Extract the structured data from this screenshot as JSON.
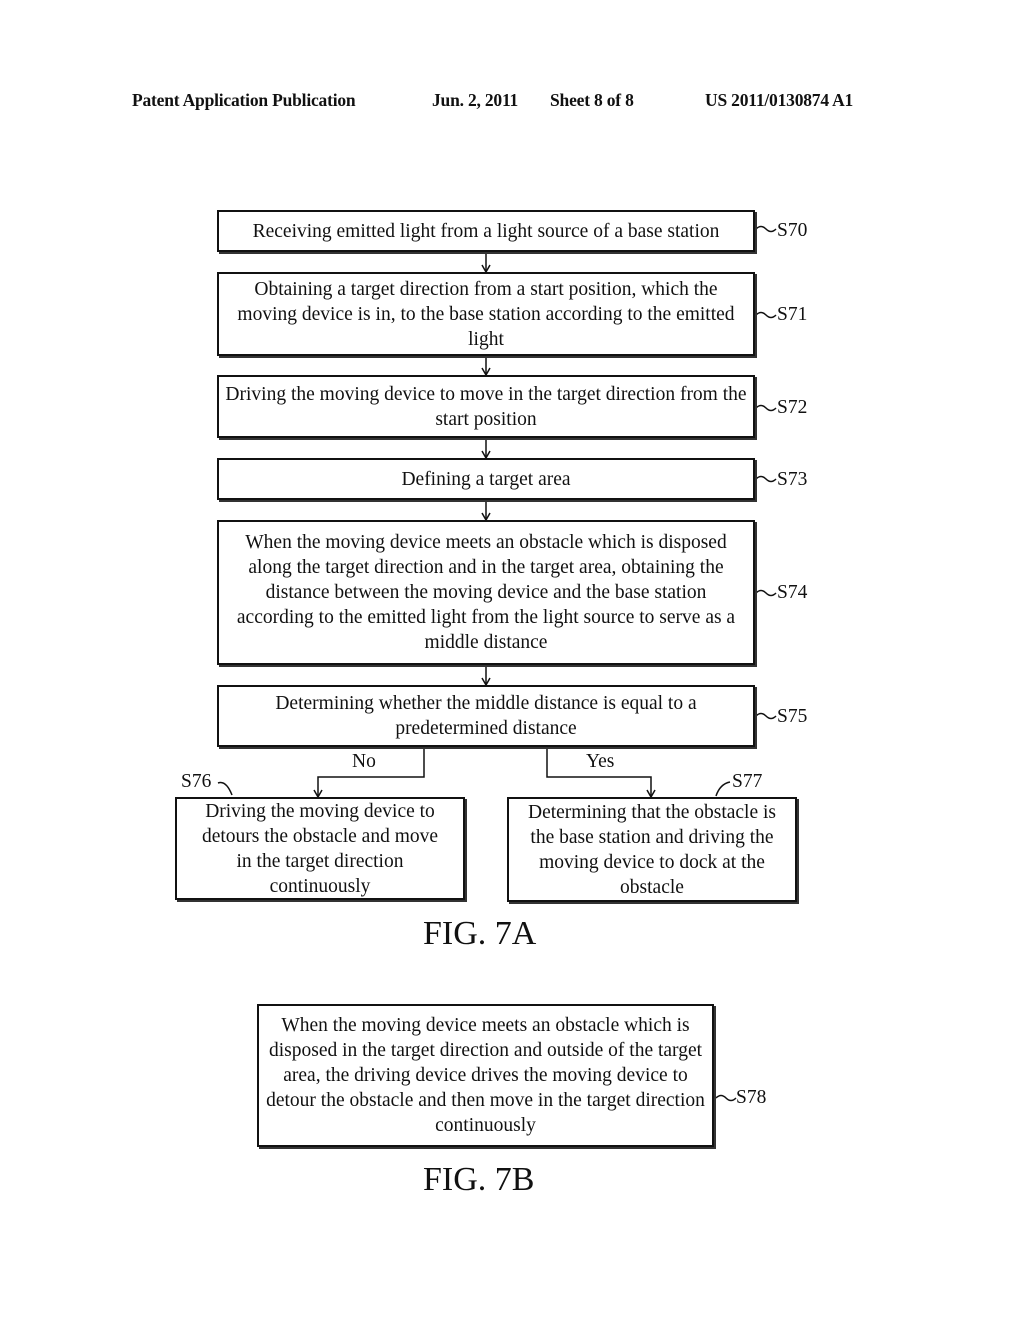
{
  "header": {
    "left": "Patent Application Publication",
    "date": "Jun. 2, 2011",
    "sheet": "Sheet 8 of 8",
    "pub_number": "US 2011/0130874 A1"
  },
  "fig7a": {
    "caption": "FIG. 7A",
    "steps": [
      {
        "id": "S70",
        "text": "Receiving emitted light from a light source of a base station"
      },
      {
        "id": "S71",
        "text": "Obtaining a target direction from a start position, which the moving device is in, to the base station according to the emitted light"
      },
      {
        "id": "S72",
        "text": "Driving the moving device to move in the target direction from the start position"
      },
      {
        "id": "S73",
        "text": "Defining a target area"
      },
      {
        "id": "S74",
        "text": "When the moving device meets an obstacle which is disposed along the target direction and in the target area, obtaining the distance between the moving device and the base station according to the emitted light from the light source to serve as a middle distance"
      },
      {
        "id": "S75",
        "text": "Determining whether the middle distance is equal to a predetermined distance"
      },
      {
        "id": "S76",
        "text": "Driving the moving device to detours the obstacle and move in the target direction continuously"
      },
      {
        "id": "S77",
        "text": "Determining that the obstacle is the base station and driving the moving device to dock at the obstacle"
      }
    ],
    "branches": {
      "no": "No",
      "yes": "Yes"
    }
  },
  "fig7b": {
    "caption": "FIG. 7B",
    "steps": [
      {
        "id": "S78",
        "text": "When the moving device meets an obstacle which is disposed in the target direction and outside of the target area, the driving device drives the moving device to detour the obstacle and then move in the target direction continuously"
      }
    ]
  }
}
